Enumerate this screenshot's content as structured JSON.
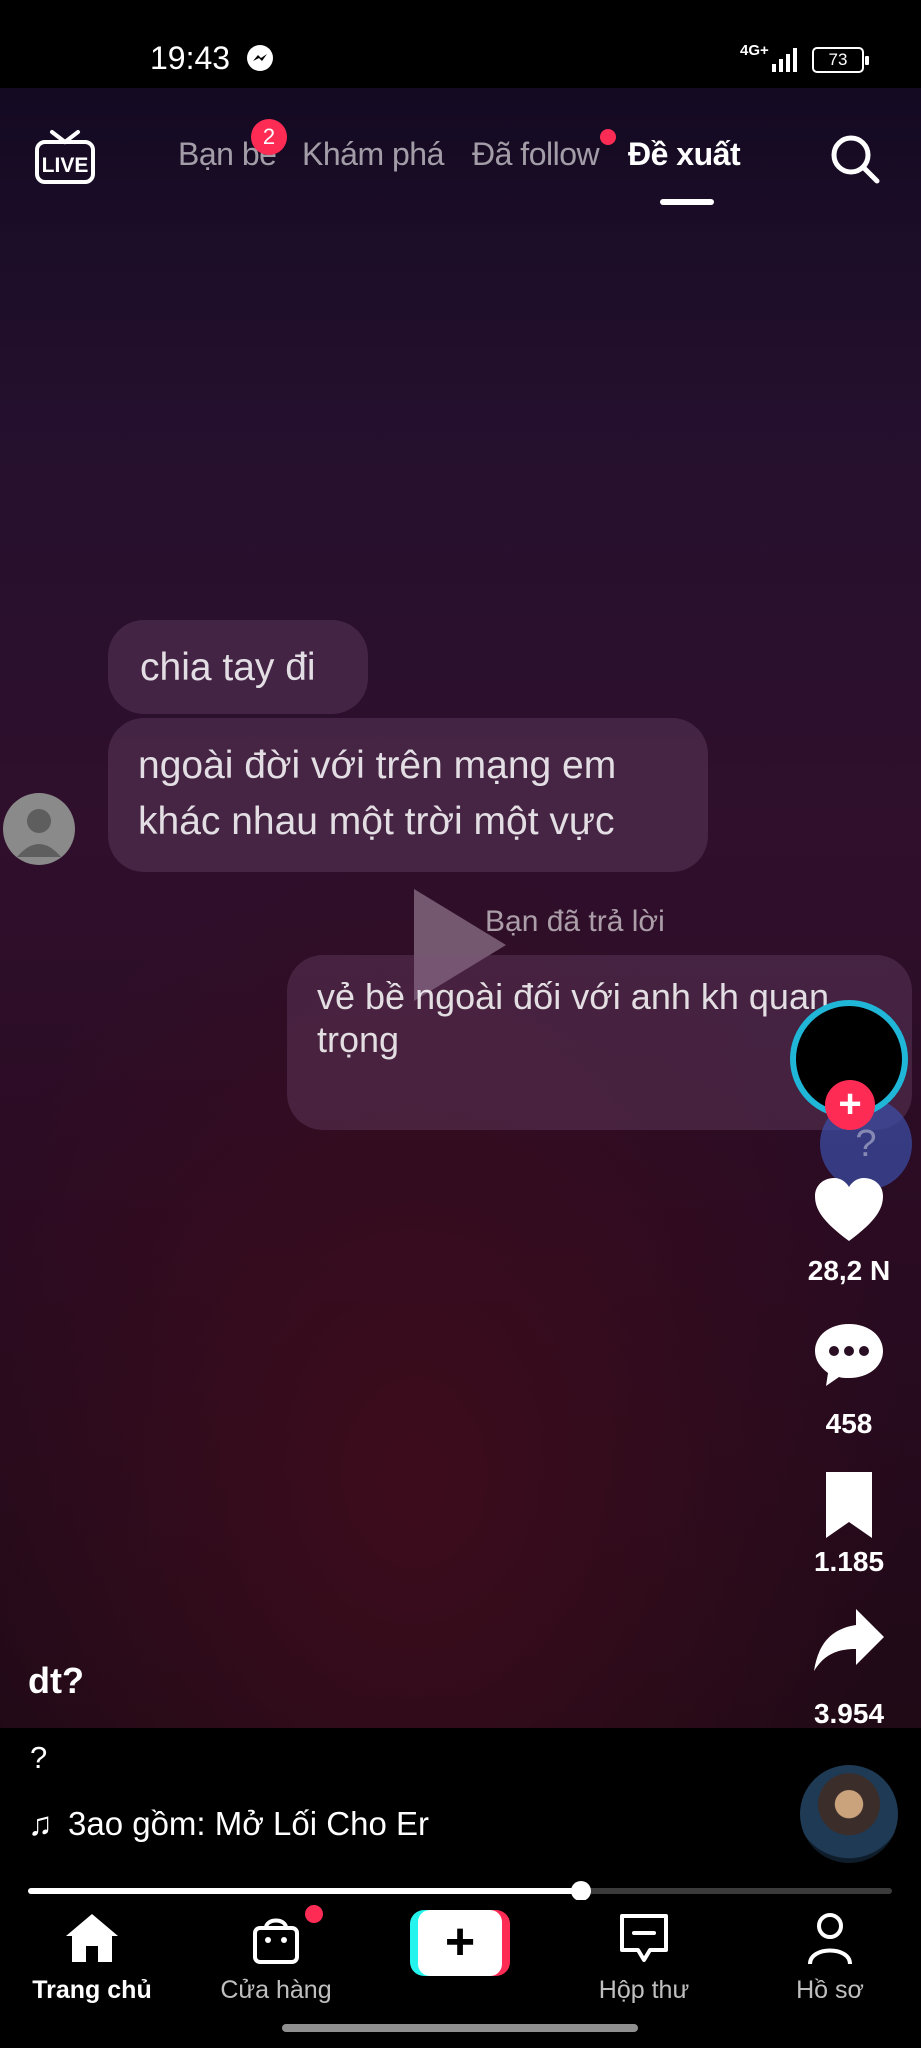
{
  "status_bar": {
    "time": "19:43",
    "network": "4G+",
    "battery": "73"
  },
  "top_nav": {
    "tabs": [
      {
        "label": "Bạn bè",
        "badge": "2"
      },
      {
        "label": "Khám phá"
      },
      {
        "label": "Đã follow",
        "dot": true
      },
      {
        "label": "Đề xuất",
        "active": true
      }
    ]
  },
  "video": {
    "messages": [
      "chia tay đi",
      "ngoài đời với trên mạng em khác nhau một trời một vực",
      "vẻ bề ngoài đối với anh kh quan trọng"
    ],
    "reply_label": "Bạn đã trả lời",
    "progress": 0.64
  },
  "actions": {
    "likes": "28,2 N",
    "comments": "458",
    "saves": "1.185",
    "shares": "3.954"
  },
  "caption": {
    "title": "dt?",
    "description": "?",
    "music": "3ao gồm: Mở Lối Cho Er"
  },
  "bottom_nav": {
    "home": "Trang chủ",
    "shop": "Cửa hàng",
    "inbox": "Hộp thư",
    "profile": "Hồ sơ"
  },
  "colors": {
    "accent_red": "#fe2c55",
    "accent_cyan": "#25f4ee",
    "avatar_ring": "#1fb6d8"
  }
}
